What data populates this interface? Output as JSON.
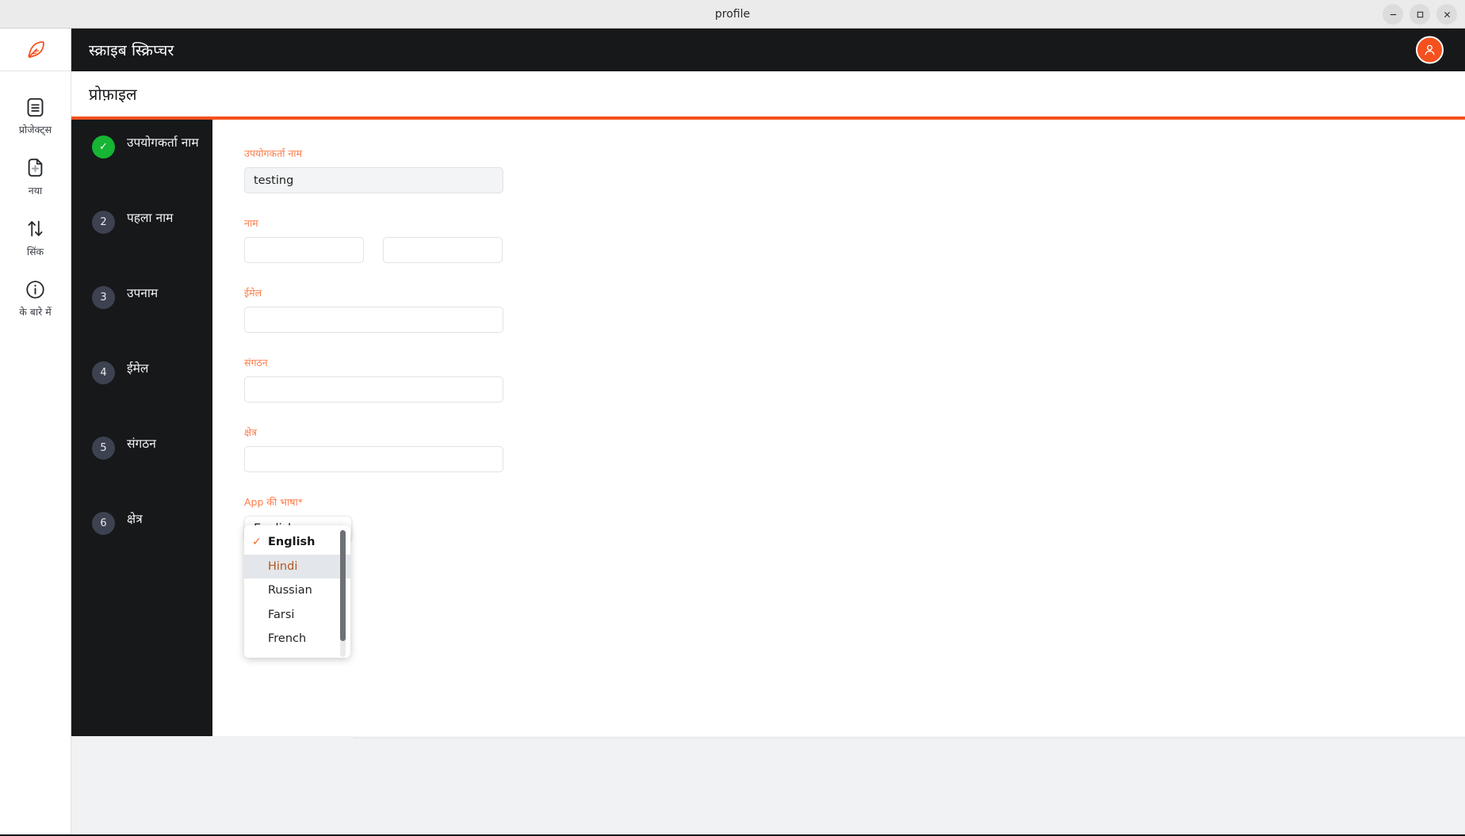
{
  "window": {
    "title": "profile",
    "minimize_label": "–",
    "maximize_label": "❐",
    "close_label": "✕"
  },
  "rail": {
    "logo_icon": "feather-quill-icon",
    "items": [
      {
        "label": "प्रोजेक्ट्स",
        "icon": "document-list-icon"
      },
      {
        "label": "नया",
        "icon": "new-document-plus-icon"
      },
      {
        "label": "सिंक",
        "icon": "sync-arrows-icon"
      },
      {
        "label": "के बारे में",
        "icon": "info-circle-icon"
      }
    ]
  },
  "appbar": {
    "title": "स्क्राइब स्क्रिप्चर",
    "avatar_icon": "user-avatar-icon"
  },
  "page": {
    "title": "प्रोफ़ाइल",
    "accent": "#f4511e"
  },
  "stepper": {
    "steps": [
      {
        "num": "✓",
        "label": "उपयोगकर्ता नाम",
        "done": true
      },
      {
        "num": "2",
        "label": "पहला नाम",
        "done": false
      },
      {
        "num": "3",
        "label": "उपनाम",
        "done": false
      },
      {
        "num": "4",
        "label": "ईमेल",
        "done": false
      },
      {
        "num": "5",
        "label": "संगठन",
        "done": false
      },
      {
        "num": "6",
        "label": "क्षेत्र",
        "done": false
      }
    ]
  },
  "form": {
    "username": {
      "label": "उपयोगकर्ता नाम",
      "value": "testing",
      "placeholder": ""
    },
    "name": {
      "label": "नाम",
      "first_value": "",
      "first_placeholder": "",
      "last_value": "",
      "last_placeholder": ""
    },
    "email": {
      "label": "ईमेल",
      "value": "",
      "placeholder": ""
    },
    "organization": {
      "label": "संगठन",
      "value": "",
      "placeholder": ""
    },
    "region": {
      "label": "क्षेत्र",
      "value": "",
      "placeholder": ""
    },
    "app_language": {
      "label": "App की भाषा*",
      "selected": "English",
      "chevron_icon": "chevron-up-down-icon",
      "options": [
        {
          "label": "English",
          "selected": true,
          "hovered": false
        },
        {
          "label": "Hindi",
          "selected": false,
          "hovered": true
        },
        {
          "label": "Russian",
          "selected": false,
          "hovered": false
        },
        {
          "label": "Farsi",
          "selected": false,
          "hovered": false
        },
        {
          "label": "French",
          "selected": false,
          "hovered": false
        }
      ],
      "check_glyph": "✓"
    }
  }
}
